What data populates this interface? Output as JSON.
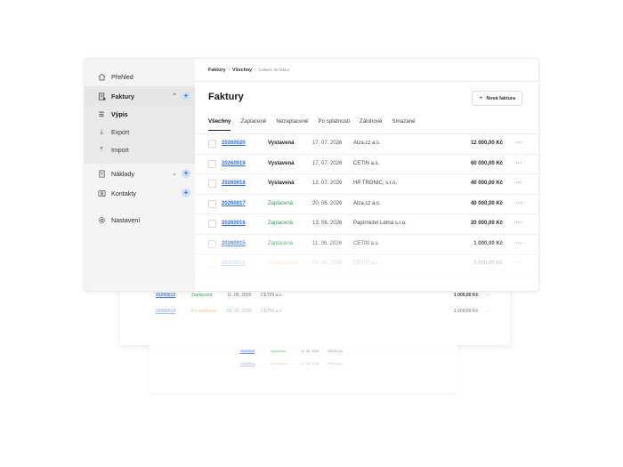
{
  "sidebar": {
    "items": [
      {
        "label": "Přehled",
        "icon": "home-icon"
      },
      {
        "label": "Faktury",
        "icon": "invoice-icon"
      },
      {
        "label": "Náklady",
        "icon": "receipt-icon"
      },
      {
        "label": "Kontakty",
        "icon": "contacts-icon"
      },
      {
        "label": "Nastavení",
        "icon": "gear-icon"
      }
    ],
    "sub_items": [
      {
        "label": "Výpis",
        "icon": "list-icon"
      },
      {
        "label": "Export",
        "icon": "download-icon"
      },
      {
        "label": "Import",
        "icon": "upload-icon"
      }
    ]
  },
  "breadcrumb": {
    "root": "Faktury",
    "current": "Všechny",
    "count": "Celkem 30 faktur"
  },
  "page": {
    "title": "Faktury",
    "new_button": "Nová faktura"
  },
  "tabs": [
    "Všechny",
    "Zaplacené",
    "Nezaplacené",
    "Po splatnosti",
    "Zálohové",
    "Smazané"
  ],
  "invoices": [
    {
      "number": "20260020",
      "status": "Vystavená",
      "status_kind": "vystavena",
      "date": "17. 07. 2026",
      "client": "Alza.cz a.s.",
      "amount": "12 000,00 Kč"
    },
    {
      "number": "20260019",
      "status": "Vystavená",
      "status_kind": "vystavena",
      "date": "17. 07. 2026",
      "client": "CETIN a.s.",
      "amount": "60 000,00 Kč"
    },
    {
      "number": "20260018",
      "status": "Vystavená",
      "status_kind": "vystavena",
      "date": "12. 07. 2026",
      "client": "HP TRONIC, s.r.o.",
      "amount": "40 000,00 Kč"
    },
    {
      "number": "20260017",
      "status": "Zaplacená",
      "status_kind": "zaplacena",
      "date": "20. 06. 2026",
      "client": "Alza.cz a.s.",
      "amount": "40 000,00 Kč"
    },
    {
      "number": "20260016",
      "status": "Zaplacená",
      "status_kind": "zaplacena",
      "date": "13. 06. 2026",
      "client": "Papírnictví Letná s.r.o.",
      "amount": "20 000,00 Kč"
    },
    {
      "number": "20260015",
      "status": "Zaplacená",
      "status_kind": "zaplacena",
      "date": "11. 06. 2026",
      "client": "CETIN a.s.",
      "amount": "1 000,00 Kč"
    },
    {
      "number": "20260014",
      "status": "Po splatnosti",
      "status_kind": "po",
      "date": "01. 06. 2026",
      "client": "CETIN a.s.",
      "amount": "1 000,00 Kč"
    }
  ],
  "more_glyph": "···",
  "colors": {
    "link": "#2f6fd6",
    "paid": "#2e9b57",
    "overdue": "#e07b22",
    "sidebar_bg": "#f4f4f4",
    "accent_plus_bg": "#cfe0f7"
  }
}
